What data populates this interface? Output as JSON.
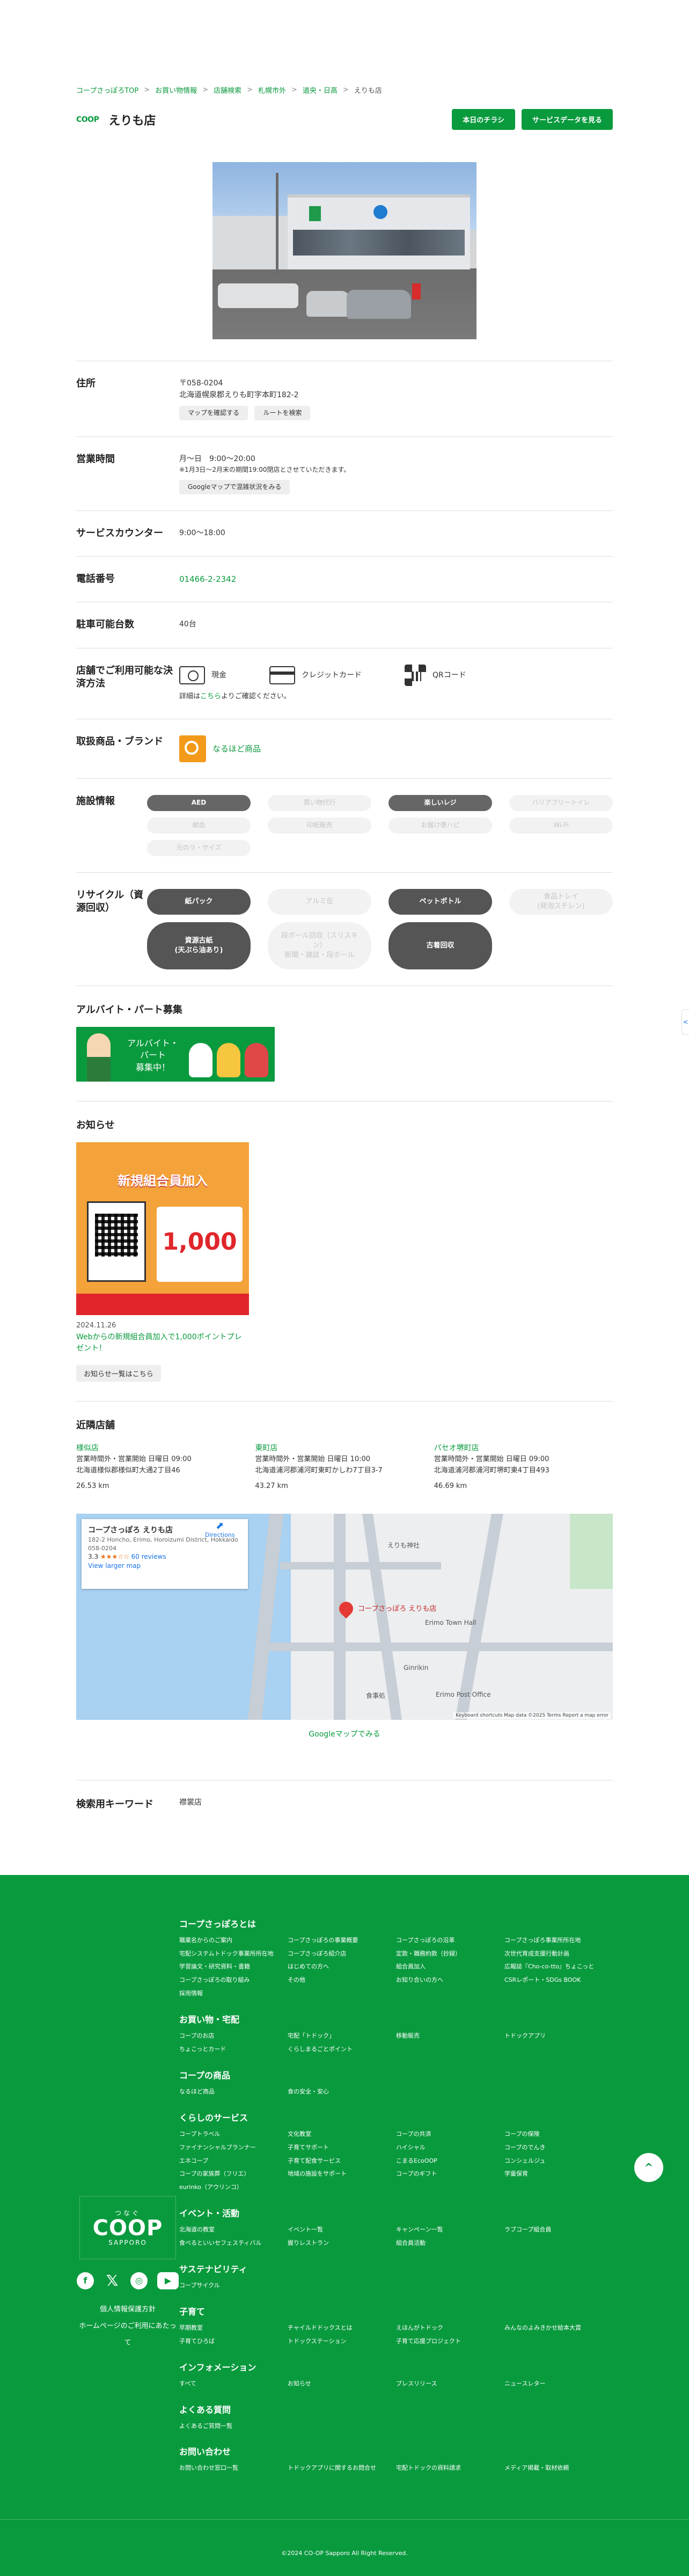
{
  "breadcrumb": [
    "コープさっぽろTOP",
    "お買い物情報",
    "店舗検索",
    "札幌市外",
    "道央・日高",
    "えりも店"
  ],
  "breadcrumb_sep": ">",
  "header": {
    "brand_mini": "COOP",
    "store_name": "えりも店",
    "flyer_button": "本日のチラシ",
    "service_button": "サービスデータを見る"
  },
  "address": {
    "label": "住所",
    "postal": "〒058-0204",
    "line": "北海道幌泉郡えりも町字本町182-2",
    "map_button": "マップを確認する",
    "route_button": "ルートを検索"
  },
  "hours": {
    "label": "営業時間",
    "main": "月～日　9:00～20:00",
    "note": "※1月3日～2月末の期間19:00閉店とさせていただきます。",
    "google_button": "Googleマップで混雑状況をみる"
  },
  "service_counter": {
    "label": "サービスカウンター",
    "value": "9:00～18:00"
  },
  "phone": {
    "label": "電話番号",
    "value": "01466-2-2342"
  },
  "parking": {
    "label": "駐車可能台数",
    "value": "40台"
  },
  "payment": {
    "label": "店舗でご利用可能な決済方法",
    "methods": [
      "現金",
      "クレジットカード",
      "QRコード"
    ],
    "note_prefix": "詳細は",
    "note_link": "こちら",
    "note_suffix": "よりご確認ください。"
  },
  "brands": {
    "label": "取扱商品・ブランド",
    "name": "なるほど商品"
  },
  "facilities": {
    "label": "施設情報",
    "items": [
      {
        "name": "AED",
        "on": true
      },
      {
        "name": "買い物代行",
        "on": false
      },
      {
        "name": "楽しいレジ",
        "on": true
      },
      {
        "name": "バリアフリートイレ",
        "on": false
      },
      {
        "name": "献血",
        "on": false
      },
      {
        "name": "印紙販売",
        "on": false
      },
      {
        "name": "お届け便ハピ",
        "on": false
      },
      {
        "name": "Wi-Fi",
        "on": false
      },
      {
        "name": "元のラ・サイズ",
        "on": false
      }
    ]
  },
  "recycle": {
    "label": "リサイクル（資源回収）",
    "items": [
      {
        "name": "紙パック",
        "on": true
      },
      {
        "name": "アルミ缶",
        "on": false
      },
      {
        "name": "ペットボトル",
        "on": true
      },
      {
        "name": "食品トレイ\n(発泡スチレン)",
        "on": false
      },
      {
        "name": "資源古紙\n(天ぷら油あり)",
        "on": true
      },
      {
        "name": "段ボール回収（スリスキ\nン）\n新聞・雑誌・段ボール",
        "on": false
      },
      {
        "name": "古着回収",
        "on": true
      }
    ]
  },
  "job": {
    "title": "アルバイト・パート募集",
    "banner_text": "アルバイト・\nパート\n募集中！"
  },
  "news": {
    "title": "お知らせ",
    "image_headline": "新規組合員加入",
    "image_points": "1,000",
    "date": "2024.11.26",
    "article_title": "Webからの新規組合員加入で1,000ポイントプレゼント！",
    "more_button": "お知らせ一覧はこちら"
  },
  "nearby": {
    "title": "近隣店舗",
    "stores": [
      {
        "name": "様似店",
        "hours": "営業時間外・営業開始 日曜日 09:00",
        "address": "北海道様似郡様似町大通2丁目46",
        "distance": "26.53 km"
      },
      {
        "name": "東町店",
        "hours": "営業時間外・営業開始 日曜日 10:00",
        "address": "北海道浦河郡浦河町東町かしわ7丁目3-7",
        "distance": "43.27 km"
      },
      {
        "name": "パセオ堺町店",
        "hours": "営業時間外・営業開始 日曜日 09:00",
        "address": "北海道浦河郡浦河町堺町東4丁目493",
        "distance": "46.69 km"
      }
    ]
  },
  "map": {
    "card_title": "コープさっぽろ えりも店",
    "card_address": "182-2 Honcho, Erimo, Horoizumi District, Hokkaido 058-0204",
    "rating": "3.3",
    "stars": "★★★☆☆",
    "reviews": "60 reviews",
    "larger": "View larger map",
    "directions": "Directions",
    "pin_label": "コープさっぽろ えりも店",
    "labels": [
      "Erimo Town Hall",
      "Erimo Post Office",
      "えりも神社",
      "Ginrikin",
      "食事処"
    ],
    "attribution": "Keyboard shortcuts   Map data ©2025   Terms   Report a map error",
    "link": "Googleマップでみる"
  },
  "keyword": {
    "label": "検索用キーワード",
    "value": "襟裳店"
  },
  "footer": {
    "coop_top": "つなぐ",
    "coop_main": "COOP",
    "coop_sub": "SAPPORO",
    "privacy": "個人情報保護方針",
    "terms": "ホームページのご利用にあたって",
    "to_top": "^",
    "copyright": "©2024 CO-OP Sapporo All Right Reserved.",
    "groups": [
      {
        "title": "コープさっぽろとは",
        "links": [
          "職業名からのご案内",
          "コープさっぽろの事業概要",
          "コープさっぽろの沿革",
          "コープさっぽろ事業所所在地",
          "宅配システムトドック事業所所在地",
          "コープさっぽろ紹介店",
          "定款・職務約款（抄録）",
          "次世代育成支援行動計画",
          "学習論文・研究資料・書籍",
          "はじめての方へ",
          "組合員加入",
          "広報誌『Cho-co-tto』ちょこっと",
          "コープさっぽろの取り組み",
          "その他",
          "お知り合いの方へ",
          "CSRレポート・SDGs BOOK",
          "採用情報"
        ]
      },
      {
        "title": "お買い物・宅配",
        "links": [
          "コープのお店",
          "宅配「トドック」",
          "移動販売",
          "トドックアプリ",
          "ちょこっとカード",
          "くらしまるごとポイント"
        ]
      },
      {
        "title": "コープの商品",
        "links": [
          "なるほど商品",
          "食の安全・安心"
        ]
      },
      {
        "title": "くらしのサービス",
        "links": [
          "コープトラベル",
          "文化教室",
          "コープの共済",
          "コープの保険",
          "ファイナンシャルプランナー",
          "子育てサポート",
          "ハイシャル",
          "コープのでんき",
          "エネコープ",
          "子育て配食サービス",
          "こまるEcoOOP",
          "コンシェルジュ",
          "コープの家族葬（フリエ）",
          "地域の施設をサポート",
          "コープのギフト",
          "学童保育",
          "eurinko（アウリンコ）"
        ]
      },
      {
        "title": "イベント・活動",
        "links": [
          "北海道の教室",
          "イベント一覧",
          "キャンペーン一覧",
          "ラブコープ組合員",
          "食べるといいセフェスティバル",
          "握りレストラン",
          "組合員活動"
        ]
      },
      {
        "title": "サステナビリティ",
        "links": [
          "コープサイクル"
        ]
      },
      {
        "title": "子育て",
        "links": [
          "早期教室",
          "チャイルドドックスとは",
          "えほんがトドック",
          "みんなのよみきかせ絵本大賞",
          "子育てひろば",
          "トドックステーション",
          "子育て応援プロジェクト"
        ]
      },
      {
        "title": "インフォメーション",
        "links": [
          "すべて",
          "お知らせ",
          "プレスリリース",
          "ニュースレター"
        ]
      },
      {
        "title": "よくある質問",
        "links": [
          "よくあるご質問一覧"
        ]
      },
      {
        "title": "お問い合わせ",
        "links": [
          "お問い合わせ窓口一覧",
          "トドックアプリに関するお問合せ",
          "宅配トドックの資料請求",
          "メディア掲載・取材依頼"
        ]
      }
    ]
  }
}
